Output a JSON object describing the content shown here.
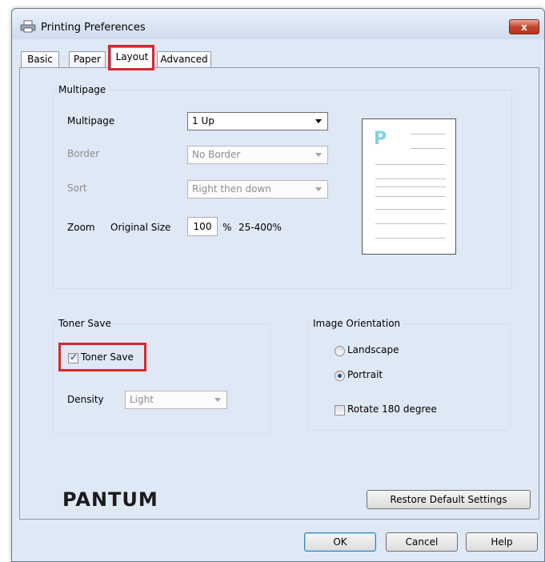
{
  "window": {
    "title": "Printing Preferences",
    "close_symbol": "x"
  },
  "tabs": [
    {
      "label": "Basic"
    },
    {
      "label": "Paper"
    },
    {
      "label": "Layout"
    },
    {
      "label": "Advanced"
    }
  ],
  "active_tab": "Layout",
  "multipage_group": {
    "legend": "Multipage",
    "multipage_label": "Multipage",
    "multipage_value": "1 Up",
    "border_label": "Border",
    "border_value": "No Border",
    "sort_label": "Sort",
    "sort_value": "Right then down",
    "zoom_label": "Zoom",
    "zoom_mode": "Original Size",
    "zoom_value": "100",
    "zoom_unit": "%",
    "zoom_range": "25-400%"
  },
  "preview": {
    "letter": "P"
  },
  "toner_group": {
    "legend": "Toner Save",
    "checkbox_label": "Toner Save",
    "checked": true,
    "density_label": "Density",
    "density_value": "Light"
  },
  "orientation_group": {
    "legend": "Image Orientation",
    "landscape_label": "Landscape",
    "portrait_label": "Portrait",
    "selected": "Portrait",
    "rotate_label": "Rotate 180 degree",
    "rotate_checked": false
  },
  "brand": {
    "logo_text": "PANTUM"
  },
  "buttons": {
    "restore": "Restore Default Settings",
    "ok": "OK",
    "cancel": "Cancel",
    "help": "Help"
  },
  "colors": {
    "highlight": "#d6282e",
    "title_bar": "#dfe8f5",
    "close_button": "#c2442d"
  }
}
